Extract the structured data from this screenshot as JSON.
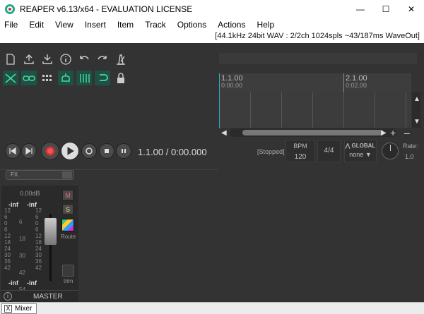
{
  "window": {
    "title": "REAPER v6.13/x64 - EVALUATION LICENSE"
  },
  "menu": [
    "File",
    "Edit",
    "View",
    "Insert",
    "Item",
    "Track",
    "Options",
    "Actions",
    "Help"
  ],
  "status": "[44.1kHz 24bit WAV : 2/2ch 1024spls ~43/187ms WaveOut]",
  "timeline": {
    "marks": [
      {
        "label": "1.1.00",
        "sub": "0:00.00"
      },
      {
        "label": "2.1.00",
        "sub": "0:02.00"
      }
    ]
  },
  "transport": {
    "position": "1.1.00 / 0:00.000",
    "state": "[Stopped]",
    "bpm_label": "BPM",
    "bpm": "120",
    "time_sig": "4/4",
    "global_label": "GLOBAL",
    "global_value": "none",
    "rate_label": "Rate:",
    "rate_value": "1.0"
  },
  "master": {
    "fx_label": "FX",
    "db": "0.00dB",
    "peak_left": "-inf",
    "peak_right": "-inf",
    "bottom_left": "-inf",
    "bottom_right": "-inf",
    "scale_left": [
      "12",
      "6",
      "0",
      "6",
      "12",
      "18",
      "24",
      "30",
      "36",
      "42"
    ],
    "scale_mid": [
      "6",
      "18",
      "30",
      "42",
      "54"
    ],
    "scale_inner": [
      "-",
      "-",
      "-",
      "-",
      "-",
      "-",
      "-",
      "-",
      "-"
    ],
    "scale_right": [
      "12",
      "6",
      "0",
      "6",
      "12",
      "18",
      "24",
      "30",
      "36",
      "42"
    ],
    "scale_mid2": [
      "6",
      "18",
      "30",
      "42",
      "54"
    ],
    "mute": "M",
    "solo": "S",
    "route": "Route",
    "trim": "trim",
    "name": "MASTER",
    "info": "i"
  },
  "docker": {
    "tab": "Mixer",
    "close": "X"
  }
}
